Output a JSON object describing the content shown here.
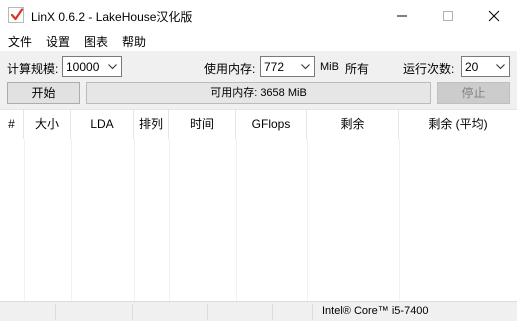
{
  "window": {
    "title": "LinX 0.6.2 - LakeHouse汉化版"
  },
  "menu": [
    "文件",
    "设置",
    "图表",
    "帮助"
  ],
  "controls": {
    "problem_size_label": "计算规模:",
    "problem_size_value": "10000",
    "memory_label": "使用内存:",
    "memory_value": "772",
    "memory_unit": "MiB",
    "all_label": "所有",
    "runs_label": "运行次数:",
    "runs_value": "20",
    "start_button": "开始",
    "stop_button": "停止",
    "available_memory": "可用内存: 3658 MiB",
    "progress_fraction": 0
  },
  "table": {
    "headers": [
      "#",
      "大小",
      "LDA",
      "排列",
      "时间",
      "GFlops",
      "剩余",
      "剩余 (平均)"
    ],
    "rows": []
  },
  "status": {
    "cpu": "Intel® Core™ i5-7400"
  },
  "colors": {
    "toolbar_bg": "#f0f0f0",
    "button_bg": "#e1e1e1",
    "progress_bg": "#e6e6e6"
  }
}
